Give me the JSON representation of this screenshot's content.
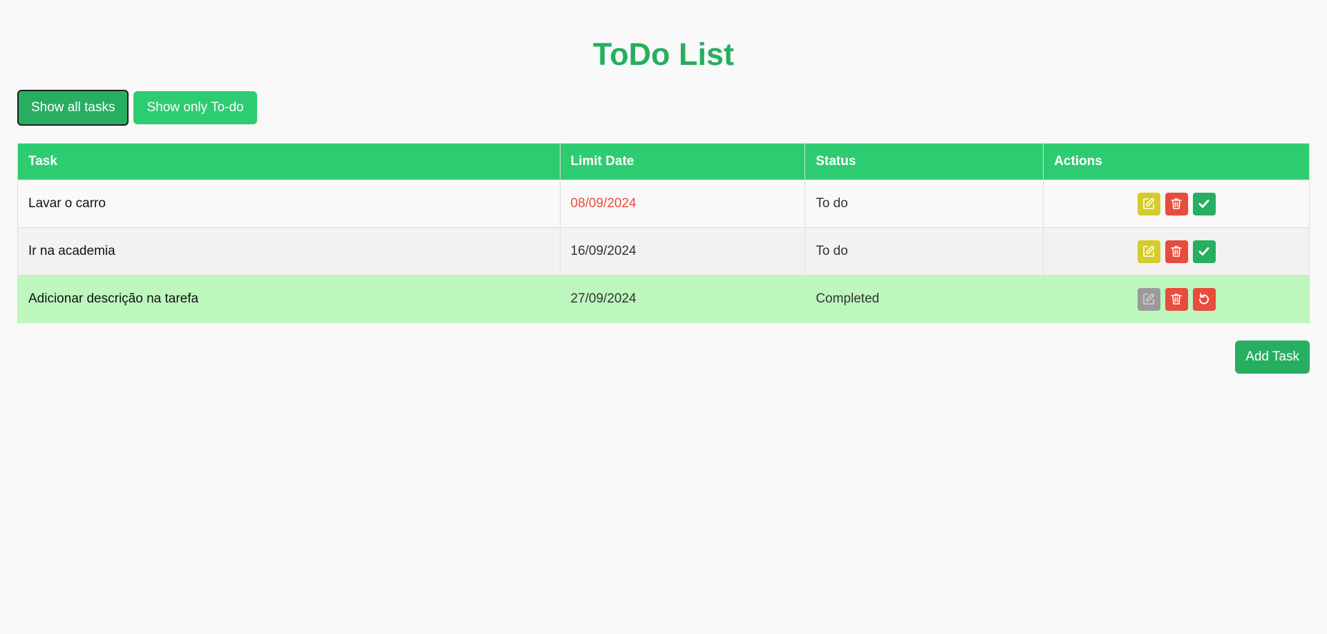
{
  "app": {
    "title": "ToDo List"
  },
  "filters": {
    "show_all_label": "Show all tasks",
    "show_todo_label": "Show only To-do",
    "active": "all"
  },
  "table": {
    "headers": {
      "task": "Task",
      "limit_date": "Limit Date",
      "status": "Status",
      "actions": "Actions"
    },
    "rows": [
      {
        "task": "Lavar o carro",
        "limit_date": "08/09/2024",
        "status": "To do",
        "overdue": true,
        "completed": false
      },
      {
        "task": "Ir na academia",
        "limit_date": "16/09/2024",
        "status": "To do",
        "overdue": false,
        "completed": false
      },
      {
        "task": "Adicionar descrição na tarefa",
        "limit_date": "27/09/2024",
        "status": "Completed",
        "overdue": false,
        "completed": true
      }
    ]
  },
  "footer": {
    "add_task_label": "Add Task"
  },
  "icons": {
    "edit": "pencil-square-icon",
    "delete": "trash-icon",
    "complete": "check-icon",
    "undo": "rotate-ccw-icon"
  },
  "colors": {
    "brand_green": "#27ae60",
    "light_green": "#2ecc71",
    "overdue_red": "#e74c3c",
    "edit_yellow": "#d4cc2a",
    "disabled_gray": "#9a9a9a",
    "completed_row": "#bdf7bd"
  }
}
